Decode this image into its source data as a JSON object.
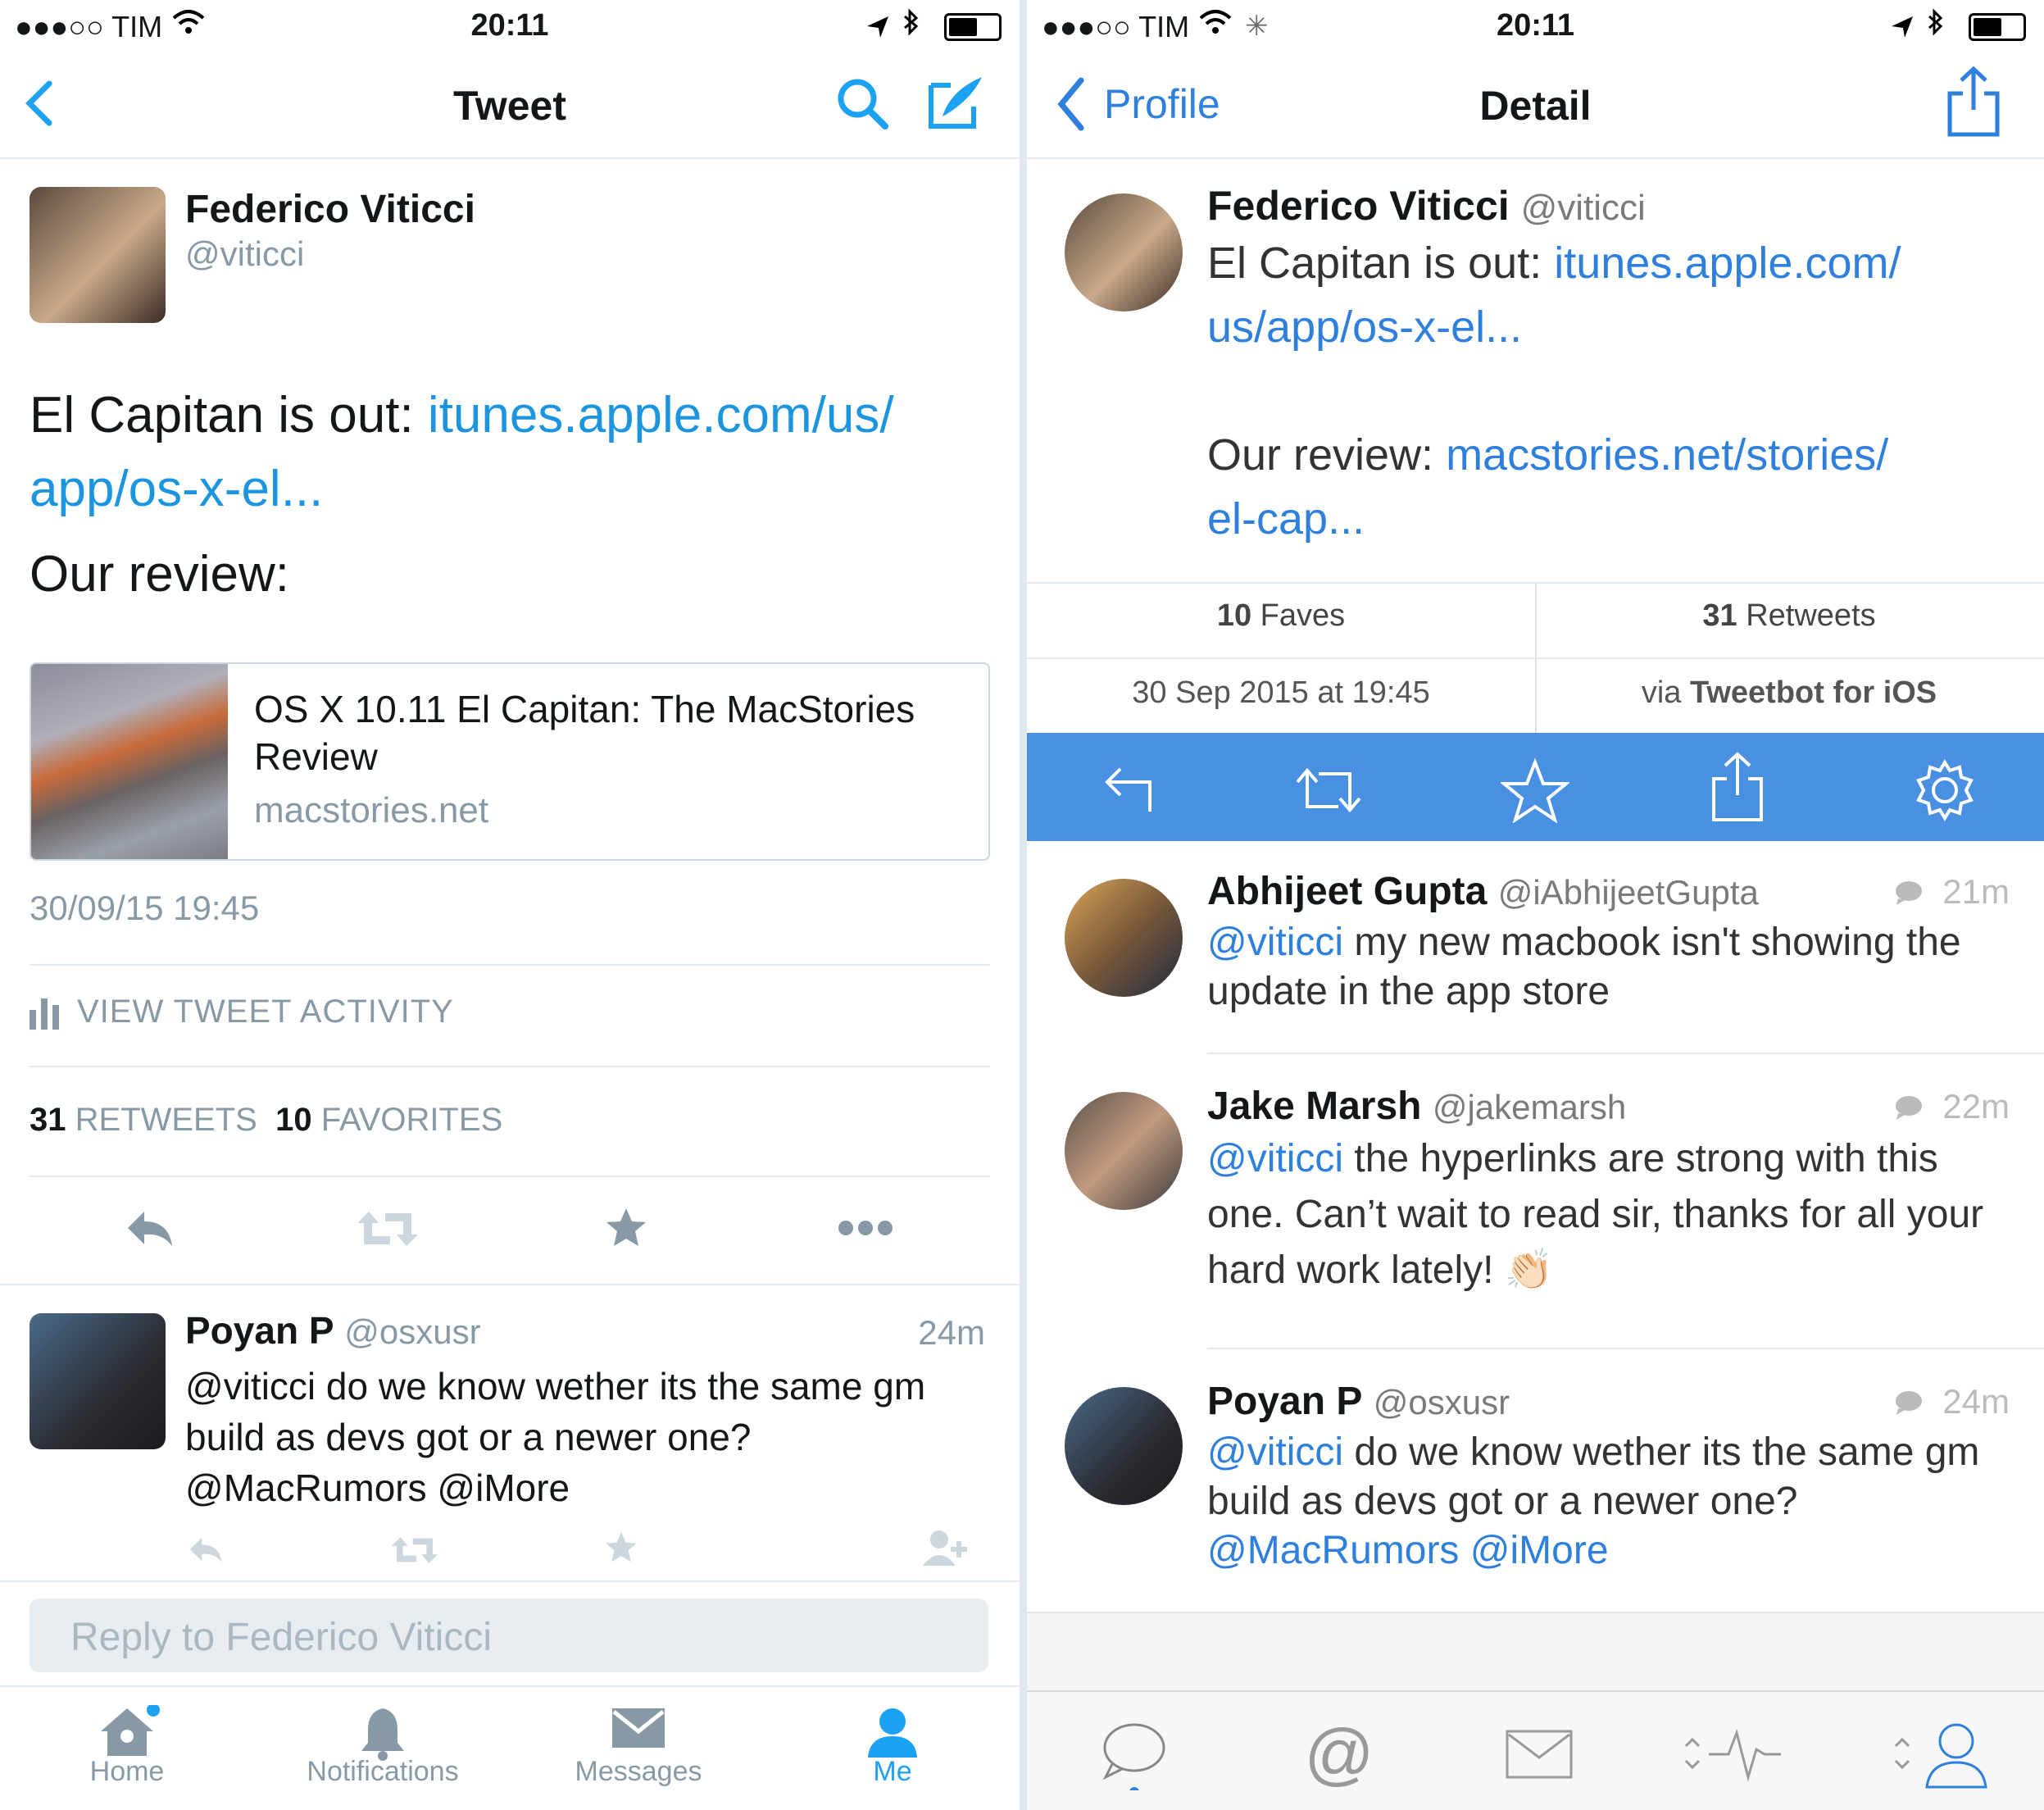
{
  "left": {
    "status": {
      "carrier": "●●●○○ TIM",
      "time": "20:11"
    },
    "nav": {
      "title": "Tweet"
    },
    "author": {
      "name": "Federico Viticci",
      "handle": "@viticci"
    },
    "tweet": {
      "text_prefix": "El Capitan is out: ",
      "link1_line1": "itunes.apple.com/us/",
      "link1_line2": "app/os-x-el...",
      "review": "Our review:"
    },
    "card": {
      "title": "OS X 10.11 El Capitan: The MacStories Review",
      "domain": "macstories.net"
    },
    "timestamp": "30/09/15 19:45",
    "activity_label": "VIEW TWEET ACTIVITY",
    "stats": {
      "retweets_count": "31",
      "retweets_label": "RETWEETS",
      "favorites_count": "10",
      "favorites_label": "FAVORITES"
    },
    "reply": {
      "name": "Poyan P",
      "handle": "@osxusr",
      "time": "24m",
      "text": "@viticci do we know wether its the same gm build as devs got or a newer one? @MacRumors @iMore"
    },
    "reply_placeholder": "Reply to Federico Viticci",
    "tabs": [
      "Home",
      "Notifications",
      "Messages",
      "Me"
    ],
    "colors": {
      "accent": "#1da1f2",
      "muted": "#8899a6"
    }
  },
  "right": {
    "status": {
      "carrier": "●●●○○ TIM",
      "time": "20:11"
    },
    "nav": {
      "back": "Profile",
      "title": "Detail"
    },
    "author": {
      "name": "Federico Viticci",
      "handle": "@viticci"
    },
    "tweet": {
      "text_prefix": "El Capitan is out: ",
      "link1_line1": "itunes.apple.com/",
      "link1_line2": "us/app/os-x-el...",
      "review_prefix": "Our review: ",
      "link2_line1": "macstories.net/stories/",
      "link2_line2": "el-cap..."
    },
    "meta": {
      "faves_count": "10",
      "faves_label": "Faves",
      "retweets_count": "31",
      "retweets_label": "Retweets",
      "date": "30 Sep 2015 at 19:45",
      "via_prefix": "via ",
      "via_app": "Tweetbot for iOS"
    },
    "replies": [
      {
        "name": "Abhijeet Gupta",
        "handle": "@iAbhijeetGupta",
        "time": "21m",
        "mention": "@viticci",
        "text": " my new macbook isn't showing the update in the app store"
      },
      {
        "name": "Jake Marsh",
        "handle": "@jakemarsh",
        "time": "22m",
        "mention": "@viticci",
        "text": " the hyperlinks are strong with this one. Can’t wait to read sir, thanks for all your hard work lately! 👏🏻"
      },
      {
        "name": "Poyan P",
        "handle": "@osxusr",
        "time": "24m",
        "mention": "@viticci",
        "text": " do we know wether its the same gm build as devs got or a newer one?",
        "mentions2": "@MacRumors @iMore"
      }
    ],
    "colors": {
      "accent": "#2f7fdc",
      "action_bar": "#4a90e2"
    }
  }
}
